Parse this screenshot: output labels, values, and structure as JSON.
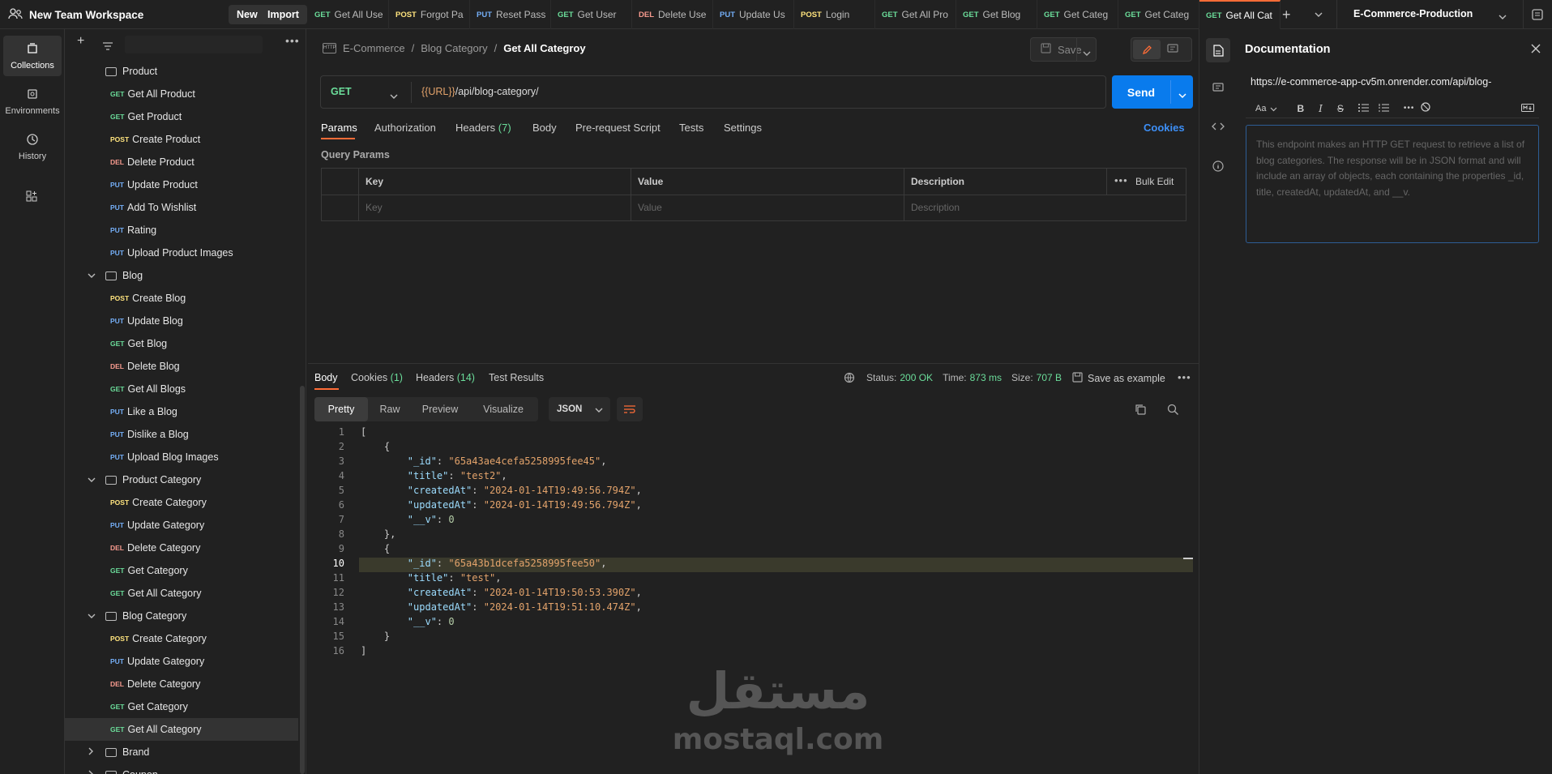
{
  "workspace": {
    "name": "New Team Workspace",
    "new_label": "New",
    "import_label": "Import"
  },
  "tabs": [
    {
      "method": "GET",
      "label": "Get All Use"
    },
    {
      "method": "POST",
      "label": "Forgot Pa"
    },
    {
      "method": "PUT",
      "label": "Reset Pass"
    },
    {
      "method": "GET",
      "label": "Get User"
    },
    {
      "method": "DEL",
      "label": "Delete Use"
    },
    {
      "method": "PUT",
      "label": "Update Us"
    },
    {
      "method": "POST",
      "label": "Login"
    },
    {
      "method": "GET",
      "label": "Get All Pro"
    },
    {
      "method": "GET",
      "label": "Get Blog"
    },
    {
      "method": "GET",
      "label": "Get Categ"
    },
    {
      "method": "GET",
      "label": "Get Categ"
    },
    {
      "method": "GET",
      "label": "Get All Cat"
    }
  ],
  "environment": "E-Commerce-Production",
  "rail": [
    {
      "label": "Collections"
    },
    {
      "label": "Environments"
    },
    {
      "label": "History"
    }
  ],
  "sidebar": {
    "items": [
      {
        "type": "folder",
        "label": "Product"
      },
      {
        "type": "req",
        "method": "GET",
        "label": "Get All Product"
      },
      {
        "type": "req",
        "method": "GET",
        "label": "Get Product"
      },
      {
        "type": "req",
        "method": "POST",
        "label": "Create Product"
      },
      {
        "type": "req",
        "method": "DEL",
        "label": "Delete Product"
      },
      {
        "type": "req",
        "method": "PUT",
        "label": "Update Product"
      },
      {
        "type": "req",
        "method": "PUT",
        "label": "Add To Wishlist"
      },
      {
        "type": "req",
        "method": "PUT",
        "label": "Rating"
      },
      {
        "type": "req",
        "method": "PUT",
        "label": "Upload Product Images"
      },
      {
        "type": "folder",
        "label": "Blog",
        "open": true
      },
      {
        "type": "req",
        "method": "POST",
        "label": "Create Blog"
      },
      {
        "type": "req",
        "method": "PUT",
        "label": "Update Blog"
      },
      {
        "type": "req",
        "method": "GET",
        "label": "Get Blog"
      },
      {
        "type": "req",
        "method": "DEL",
        "label": "Delete Blog"
      },
      {
        "type": "req",
        "method": "GET",
        "label": "Get All Blogs"
      },
      {
        "type": "req",
        "method": "PUT",
        "label": "Like a Blog"
      },
      {
        "type": "req",
        "method": "PUT",
        "label": "Dislike a Blog"
      },
      {
        "type": "req",
        "method": "PUT",
        "label": "Upload Blog Images"
      },
      {
        "type": "folder",
        "label": "Product Category",
        "open": true
      },
      {
        "type": "req",
        "method": "POST",
        "label": "Create Category"
      },
      {
        "type": "req",
        "method": "PUT",
        "label": "Update Gategory"
      },
      {
        "type": "req",
        "method": "DEL",
        "label": "Delete Category"
      },
      {
        "type": "req",
        "method": "GET",
        "label": "Get Category"
      },
      {
        "type": "req",
        "method": "GET",
        "label": "Get All Category"
      },
      {
        "type": "folder",
        "label": "Blog Category",
        "open": true
      },
      {
        "type": "req",
        "method": "POST",
        "label": "Create Category"
      },
      {
        "type": "req",
        "method": "PUT",
        "label": "Update Gategory"
      },
      {
        "type": "req",
        "method": "DEL",
        "label": "Delete Category"
      },
      {
        "type": "req",
        "method": "GET",
        "label": "Get Category"
      },
      {
        "type": "req",
        "method": "GET",
        "label": "Get All Category",
        "selected": true
      },
      {
        "type": "folder",
        "label": "Brand",
        "open": false
      },
      {
        "type": "folder",
        "label": "Coupon",
        "open": false
      }
    ]
  },
  "breadcrumb": {
    "collection": "E-Commerce",
    "folder": "Blog Category",
    "current": "Get All Categroy"
  },
  "save_label": "Save",
  "request": {
    "method": "GET",
    "url_var": "{{URL}}",
    "url_path": "/api/blog-category/",
    "send_label": "Send"
  },
  "req_tabs": {
    "params": "Params",
    "auth": "Authorization",
    "headers": "Headers",
    "headers_count": "(7)",
    "body": "Body",
    "prereq": "Pre-request Script",
    "tests": "Tests",
    "settings": "Settings",
    "cookies": "Cookies"
  },
  "query": {
    "title": "Query Params",
    "key_h": "Key",
    "value_h": "Value",
    "desc_h": "Description",
    "bulk": "Bulk Edit",
    "key_ph": "Key",
    "value_ph": "Value",
    "desc_ph": "Description"
  },
  "response": {
    "body": "Body",
    "cookies": "Cookies",
    "cookies_count": "(1)",
    "headers": "Headers",
    "headers_count": "(14)",
    "tests": "Test Results",
    "status_label": "Status:",
    "status": "200 OK",
    "time_label": "Time:",
    "time": "873 ms",
    "size_label": "Size:",
    "size": "707 B",
    "save_example": "Save as example",
    "views": [
      "Pretty",
      "Raw",
      "Preview",
      "Visualize"
    ],
    "format": "JSON"
  },
  "code_lines": [
    "[",
    "    {",
    "        \"_id\": \"65a43ae4cefa5258995fee45\",",
    "        \"title\": \"test2\",",
    "        \"createdAt\": \"2024-01-14T19:49:56.794Z\",",
    "        \"updatedAt\": \"2024-01-14T19:49:56.794Z\",",
    "        \"__v\": 0",
    "    },",
    "    {",
    "        \"_id\": \"65a43b1dcefa5258995fee50\",",
    "        \"title\": \"test\",",
    "        \"createdAt\": \"2024-01-14T19:50:53.390Z\",",
    "        \"updatedAt\": \"2024-01-14T19:51:10.474Z\",",
    "        \"__v\": 0",
    "    }",
    "]"
  ],
  "docs": {
    "title": "Documentation",
    "url": "https://e-commerce-app-cv5m.onrender.com/api/blog-",
    "font_label": "Aa",
    "placeholder": "This endpoint makes an HTTP GET request to retrieve a list of blog categories. The response will be in JSON format and will include an array of objects, each containing the properties _id, title, createdAt, updatedAt, and __v."
  },
  "watermark": {
    "arabic": "مستقل",
    "latin": "mostaql.com"
  },
  "colors": {
    "accent": "#ff6c37",
    "send": "#097bed",
    "status_ok": "#6bdd9a"
  }
}
